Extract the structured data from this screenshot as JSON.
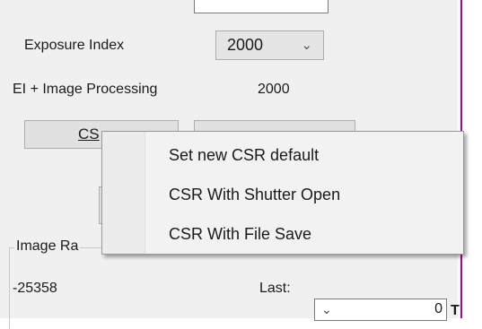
{
  "exposure_index": {
    "label": "Exposure Index",
    "value": "2000",
    "chevron_icon": "chevron-down-icon"
  },
  "ei_processing": {
    "label": "EI + Image Processing",
    "value": "2000"
  },
  "buttons": {
    "csr_visible_label": "CS"
  },
  "image_range": {
    "title": "Image Ra",
    "value": "-25358",
    "last_label": "Last:",
    "last_value": "0",
    "tick": "T"
  },
  "context_menu": {
    "items": [
      "Set new CSR default",
      "CSR With Shutter Open",
      "CSR With File Save"
    ]
  },
  "colors": {
    "panel_background": "#f0f0f0",
    "accent_border": "#b4009e"
  }
}
